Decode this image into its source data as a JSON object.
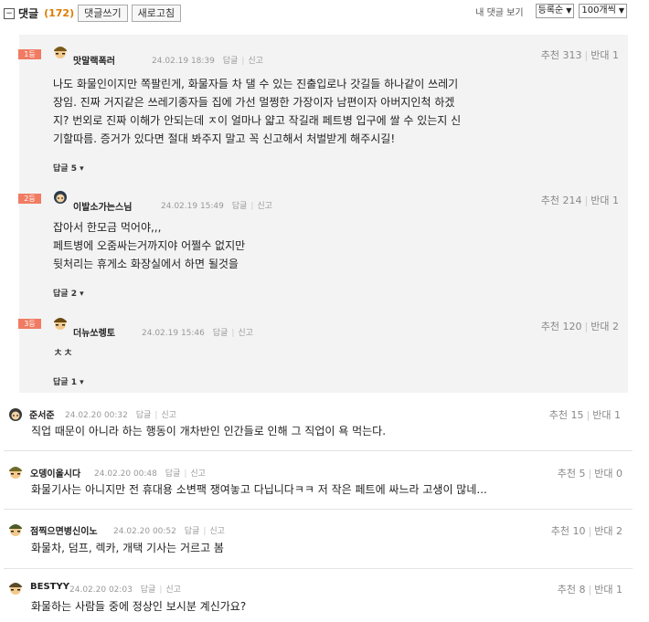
{
  "toolbar": {
    "title": "댓글",
    "count": "(172)",
    "write_label": "댓글쓰기",
    "refresh_label": "새로고침",
    "my_comments_label": "내 댓글 보기",
    "sort_value": "등록순",
    "per_page_value": "100개씩"
  },
  "best": [
    {
      "rank": "1등",
      "nick": "맛말랙폭러",
      "date": "24.02.19 18:39",
      "reply": "답글",
      "report": "신고",
      "up": "추천 313",
      "down": "반대 1",
      "lines": [
        "나도 화물인이지만 쪽팔린게, 화물자들 차 댈 수 있는 진출입로나 갓길들 하나같이 쓰레기",
        "장임. 진짜 거지같은 쓰레기종자들 집에 가선 멀쩡한 가장이자 남편이자 아버지인척 하겠",
        "지? 번외로 진짜 이해가 안되는데 ㅈ이 얼마나 얇고 작길래 페트병 입구에 쌀 수 있는지 신",
        "기할따름. 증거가 있다면 절대 봐주지 말고 꼭 신고해서 처벌받게 해주시길!"
      ],
      "replies": "답글 5"
    },
    {
      "rank": "2등",
      "nick": "이발소가는스님",
      "date": "24.02.19 15:49",
      "reply": "답글",
      "report": "신고",
      "up": "추천 214",
      "down": "반대 1",
      "lines": [
        "잡아서 한모금 먹어야,,,",
        "페트병에 오줌싸는거까지야 어쩔수 없지만",
        "뒷처리는 휴게소 화장실에서 하면 될것을"
      ],
      "replies": "답글 2"
    },
    {
      "rank": "3등",
      "nick": "더뉴쏘렝토",
      "date": "24.02.19 15:46",
      "reply": "답글",
      "report": "신고",
      "up": "추천 120",
      "down": "반대 2",
      "lines": [
        "ㅊㅊ"
      ],
      "replies": "답글 1"
    }
  ],
  "comments": [
    {
      "nick": "준서준",
      "date": "24.02.20 00:32",
      "reply": "답글",
      "report": "신고",
      "up": "추천 15",
      "down": "반대 1",
      "text": "직업 때문이 아니라 하는 행동이 개차반인 인간들로 인해 그 직업이 욕 먹는다."
    },
    {
      "nick": "오뎅이올시다",
      "date": "24.02.20 00:48",
      "reply": "답글",
      "report": "신고",
      "up": "추천 5",
      "down": "반대 0",
      "text": "화물기사는 아니지만 전 휴대용 소변팩 쟁여놓고 다닙니다ㅋㅋ 저 작은 페트에 싸느라 고생이 많네..."
    },
    {
      "nick": "점찍으면병신이노",
      "date": "24.02.20 00:52",
      "reply": "답글",
      "report": "신고",
      "up": "추천 10",
      "down": "반대 2",
      "text": "화물차, 덤프, 렉카, 개택 기사는 거르고 봄"
    },
    {
      "nick": "BESTYY",
      "date": "24.02.20 02:03",
      "reply": "답글",
      "report": "신고",
      "up": "추천 8",
      "down": "반대 1",
      "text": "화물하는 사람들 중에 정상인 보시분 계신가요?"
    }
  ],
  "colors": {
    "rank_badge": "#f07b62",
    "count": "#e07b00",
    "best_bg": "#f3f3f3"
  }
}
